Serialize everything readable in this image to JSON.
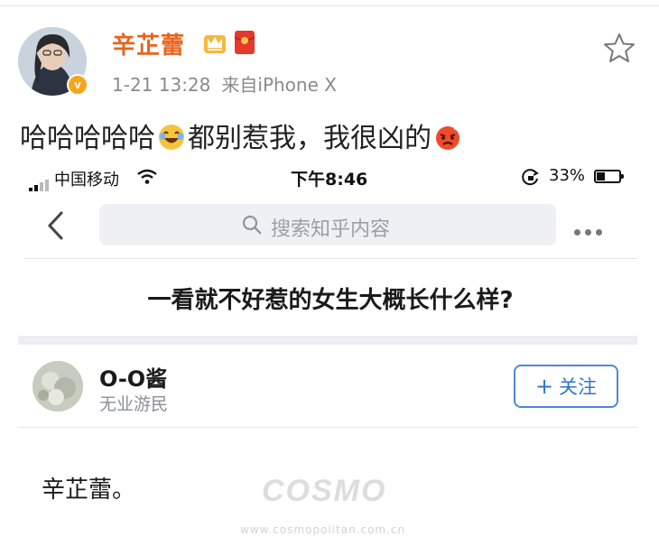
{
  "post": {
    "username": "辛芷蕾",
    "time": "1-21 13:28",
    "source": "来自iPhone X",
    "text_part1": "哈哈哈哈哈",
    "text_part2": "都别惹我，我很凶的",
    "verified_badge": "v",
    "icons": [
      "crown-icon",
      "red-packet-icon",
      "star-icon",
      "laughing-emoji",
      "angry-emoji"
    ],
    "accent_color": "#e8641e"
  },
  "phone": {
    "status_bar": {
      "carrier": "中国移动",
      "time": "下午8:46",
      "battery": "33%",
      "battery_level": 0.33
    },
    "search": {
      "placeholder": "搜索知乎内容"
    },
    "question": "一看就不好惹的女生大概长什么样?",
    "answer": {
      "author": "O-O酱",
      "bio": "无业游民",
      "follow_label": "关注",
      "follow_plus": "+",
      "body": "辛芷蕾。"
    },
    "link_color": "#2f76c9"
  },
  "watermark": {
    "logo": "COSMO",
    "url": "www.cosmopolitan.com.cn"
  }
}
